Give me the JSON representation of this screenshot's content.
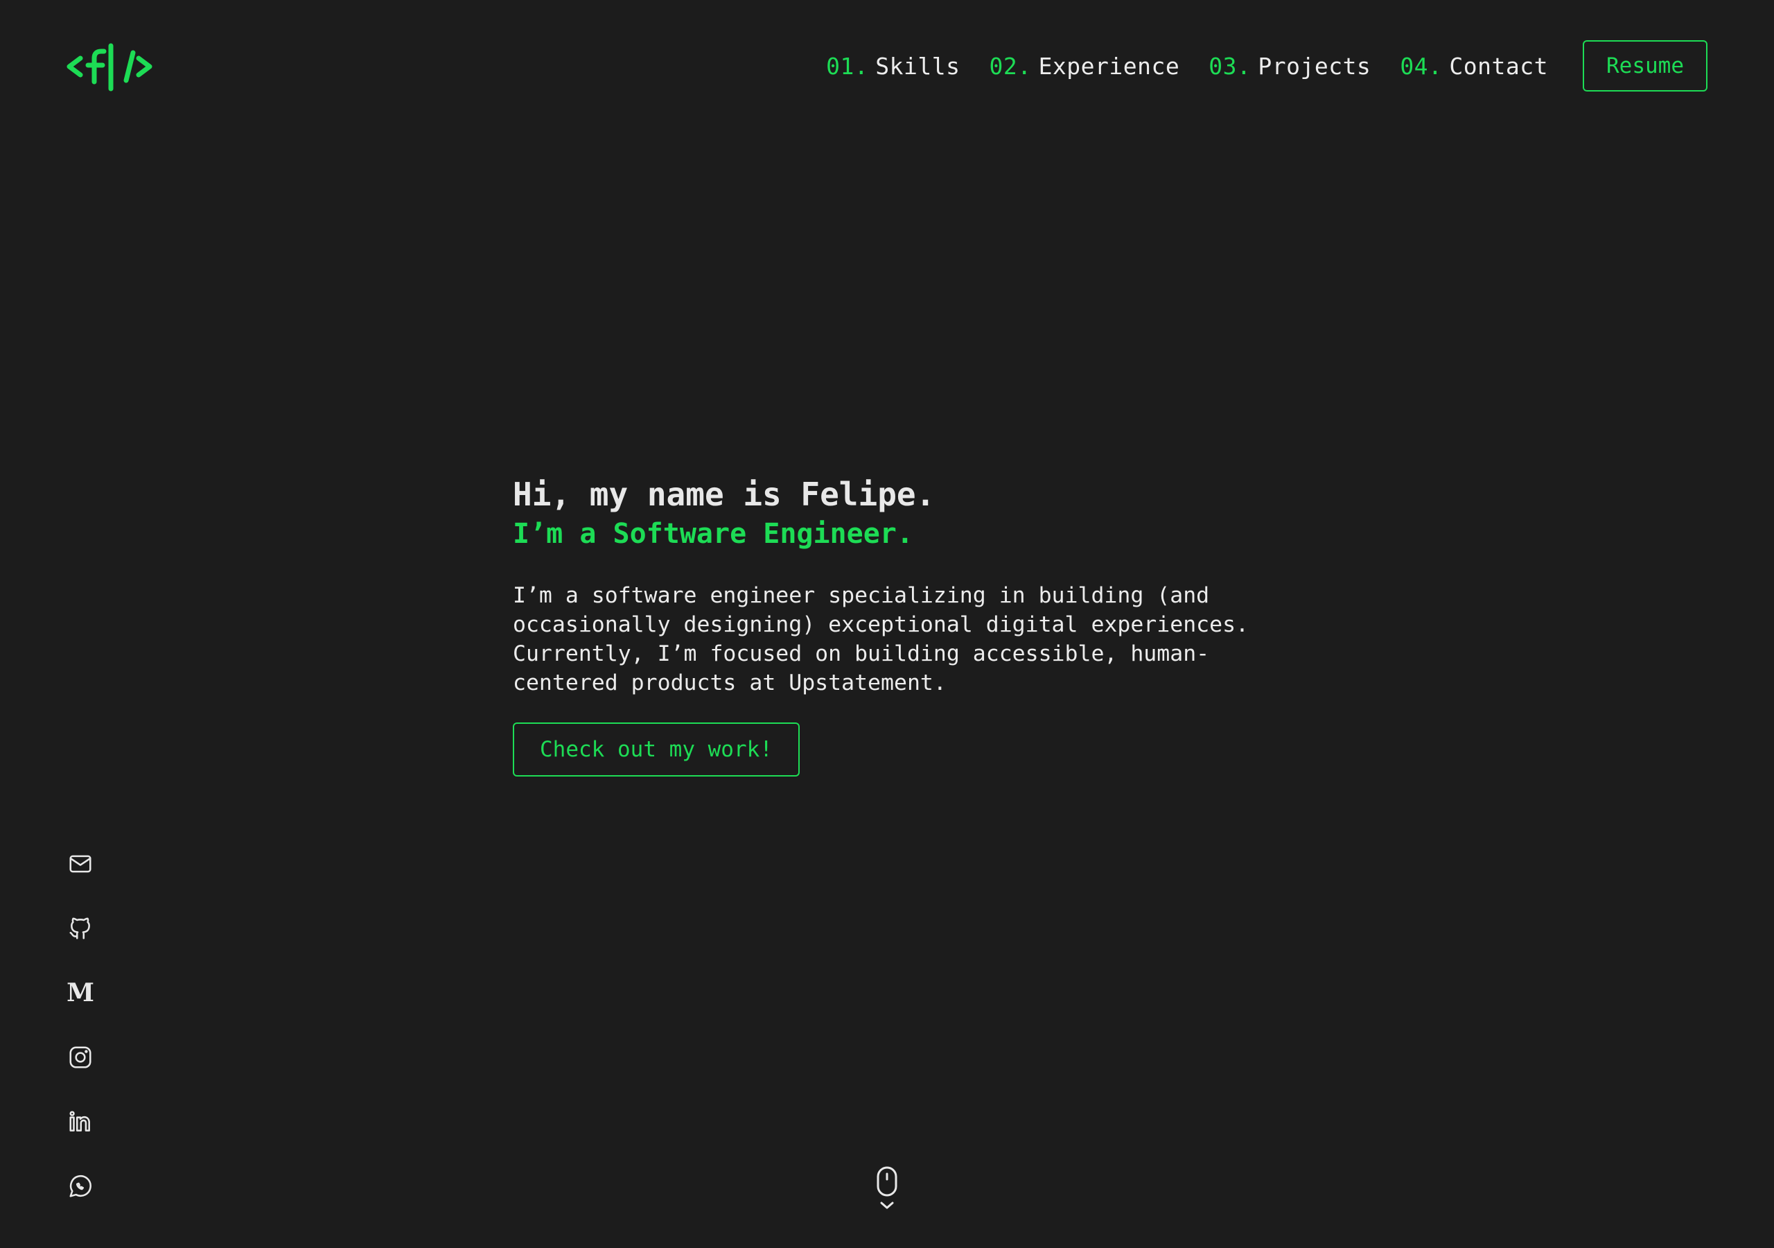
{
  "brand": {
    "logo_text": "<f|/>",
    "logo_icon": "code-brackets-logo",
    "accent_color": "#1ddc55",
    "background_color": "#1c1c1c"
  },
  "nav": {
    "items": [
      {
        "num": "01.",
        "label": "Skills"
      },
      {
        "num": "02.",
        "label": "Experience"
      },
      {
        "num": "03.",
        "label": "Projects"
      },
      {
        "num": "04.",
        "label": "Contact"
      }
    ],
    "resume_label": "Resume"
  },
  "hero": {
    "title": "Hi, my name is Felipe.",
    "subtitle": "I’m a Software Engineer.",
    "description": "I’m a software engineer specializing in building (and occasionally designing) exceptional digital experiences. Currently, I’m focused on building accessible, human-centered products at Upstatement.",
    "cta_label": "Check out my work!"
  },
  "social": {
    "icons": [
      "mail-icon",
      "github-icon",
      "medium-icon",
      "instagram-icon",
      "linkedin-icon",
      "whatsapp-icon"
    ],
    "medium_glyph": "M"
  },
  "scroll": {
    "icon": "mouse-scroll-icon"
  }
}
